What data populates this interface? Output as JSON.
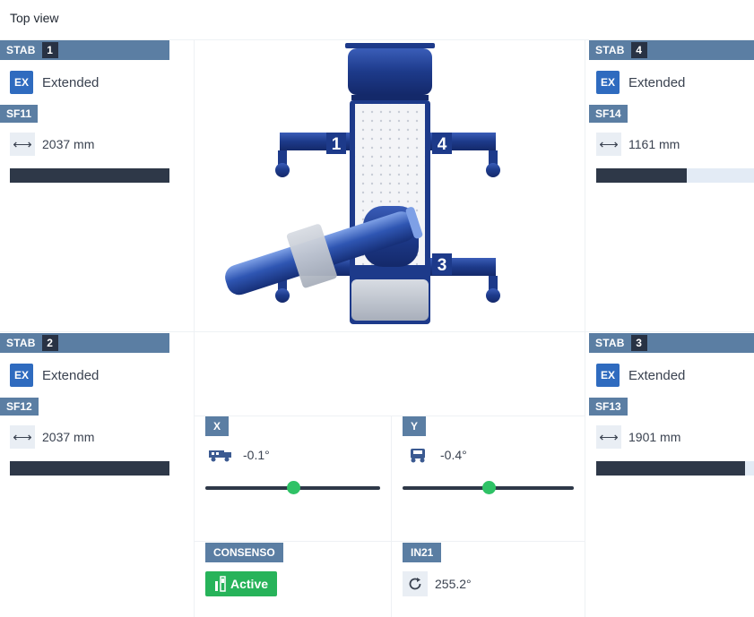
{
  "view": {
    "title": "Top view"
  },
  "stabilizers": [
    {
      "label": "STAB",
      "number": "1",
      "status_code": "EX",
      "status_text": "Extended",
      "sensor": "SF11",
      "length_icon": "horizontal-arrows-icon",
      "length": "2037 mm",
      "fill": 1.0
    },
    {
      "label": "STAB",
      "number": "4",
      "status_code": "EX",
      "status_text": "Extended",
      "sensor": "SF14",
      "length_icon": "horizontal-arrows-icon",
      "length": "1161 mm",
      "fill": 0.57
    },
    {
      "label": "STAB",
      "number": "2",
      "status_code": "EX",
      "status_text": "Extended",
      "sensor": "SF12",
      "length_icon": "horizontal-arrows-icon",
      "length": "2037 mm",
      "fill": 1.0
    },
    {
      "label": "STAB",
      "number": "3",
      "status_code": "EX",
      "status_text": "Extended",
      "sensor": "SF13",
      "length_icon": "horizontal-arrows-icon",
      "length": "1901 mm",
      "fill": 0.93
    }
  ],
  "diagram": {
    "leg_labels": [
      "1",
      "4",
      "3"
    ],
    "accent": "#1f3f8f"
  },
  "inclination": {
    "x": {
      "label": "X",
      "icon": "truck-side-icon",
      "value": "-0.1°",
      "position": 0.5
    },
    "y": {
      "label": "Y",
      "icon": "truck-front-icon",
      "value": "-0.4°",
      "position": 0.5
    }
  },
  "consent": {
    "label": "CONSENSO",
    "icon": "switch-icon",
    "state": "Active",
    "color": "#27b35a"
  },
  "rotation": {
    "label": "IN21",
    "icon": "rotation-icon",
    "value": "255.2°"
  }
}
